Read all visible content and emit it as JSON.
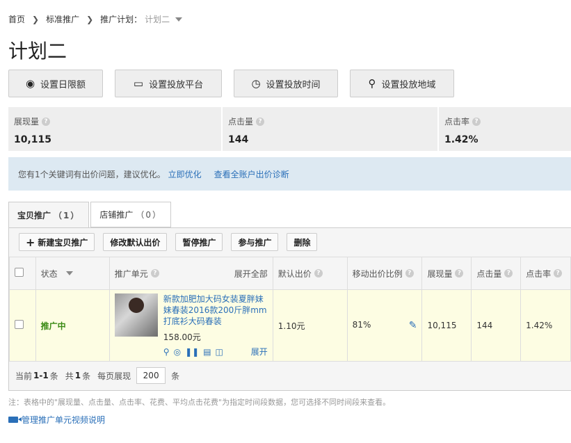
{
  "breadcrumb": {
    "home": "首页",
    "standard": "标准推广",
    "plan_label": "推广计划：",
    "plan_value": "计划二"
  },
  "page_title": "计划二",
  "actions": [
    {
      "label": "设置日限额",
      "icon": "money-bag-icon"
    },
    {
      "label": "设置投放平台",
      "icon": "monitor-icon"
    },
    {
      "label": "设置投放时间",
      "icon": "stopwatch-icon"
    },
    {
      "label": "设置投放地域",
      "icon": "map-pin-icon"
    }
  ],
  "stats": [
    {
      "label": "展现量",
      "value": "10,115"
    },
    {
      "label": "点击量",
      "value": "144"
    },
    {
      "label": "点击率",
      "value": "1.42%"
    }
  ],
  "notice": {
    "text": "您有1个关键词有出价问题，建议优化。",
    "link1": "立即优化",
    "link2": "查看全账户出价诊断"
  },
  "tabs": [
    {
      "label": "宝贝推广",
      "count": "（1）"
    },
    {
      "label": "店铺推广",
      "count": "（0）"
    }
  ],
  "toolbar": {
    "new": "新建宝贝推广",
    "modify_bid": "修改默认出价",
    "pause": "暂停推广",
    "join": "参与推广",
    "delete": "删除"
  },
  "table": {
    "headers": {
      "status": "状态",
      "unit": "推广单元",
      "expand_all": "展开全部",
      "default_bid": "默认出价",
      "mobile_ratio": "移动出价比例",
      "impressions": "展现量",
      "clicks": "点击量",
      "ctr": "点击率"
    },
    "row": {
      "status": "推广中",
      "title": "新款加肥加大码女装夏胖妹妹春装2016款200斤胖mm打底衫大码春装",
      "price": "158.00元",
      "expand": "展开",
      "default_bid": "1.10元",
      "mobile_ratio": "81%",
      "impressions": "10,115",
      "clicks": "144",
      "ctr": "1.42%"
    }
  },
  "pager": {
    "current_label": "当前",
    "range": "1-1",
    "unit1": "条",
    "total_label": "共",
    "total": "1",
    "unit2": "条",
    "per_page_label": "每页展现",
    "per_page": "200",
    "unit3": "条"
  },
  "footnote": "注：表格中的\"展现量、点击量、点击率、花费、平均点击花费\"为指定时间段数据，您可选择不同时间段来查看。",
  "video_link": "管理推广单元视频说明"
}
